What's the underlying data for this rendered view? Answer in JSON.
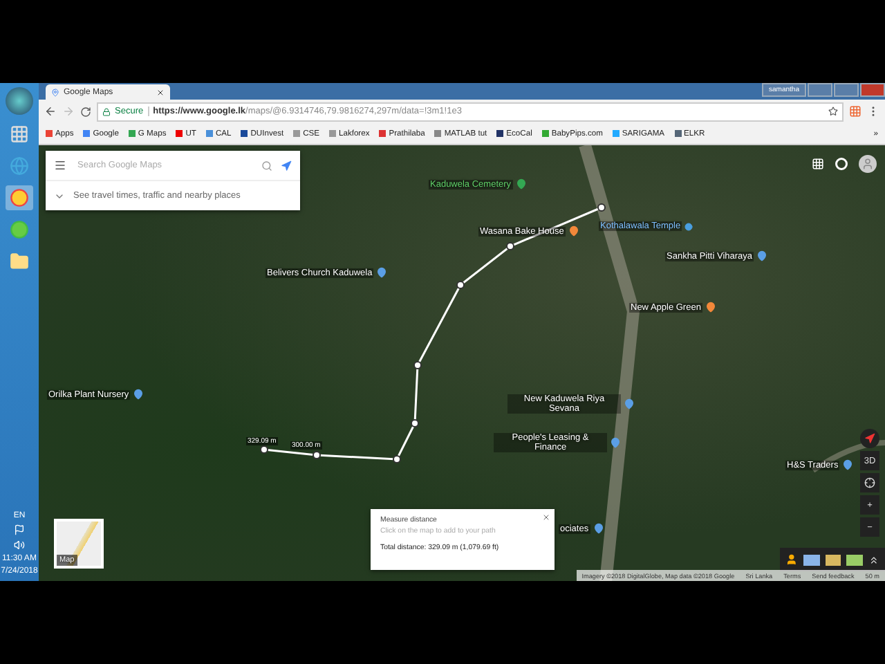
{
  "taskbar": {
    "language": "EN",
    "time": "11:30 AM",
    "date": "7/24/2018"
  },
  "window": {
    "user": "samantha",
    "tab_title": "Google Maps"
  },
  "address_bar": {
    "secure_label": "Secure",
    "url_host": "https://www.google.lk",
    "url_path": "/maps/@6.9314746,79.9816274,297m/data=!3m1!1e3"
  },
  "bookmarks": [
    "Apps",
    "Google",
    "G Maps",
    "UT",
    "CAL",
    "DUInvest",
    "CSE",
    "Lakforex",
    "Prathilaba",
    "MATLAB tut",
    "EcoCal",
    "BabyPips.com",
    "SARIGAMA",
    "ELKR"
  ],
  "bookmarks_more": "»",
  "search": {
    "placeholder": "Search Google Maps",
    "hint": "See travel times, traffic and nearby places"
  },
  "places": [
    {
      "name": "Kaduwela Cemetery",
      "kind": "park",
      "color": "#34a853"
    },
    {
      "name": "Wasana Bake House",
      "kind": "food",
      "color": "#f2883a"
    },
    {
      "name": "Kothalawala Temple",
      "kind": "transit",
      "color": "#4a9fe0"
    },
    {
      "name": "Sankha Pitti Viharaya",
      "kind": "place",
      "color": "#5b9fe6"
    },
    {
      "name": "New Apple Green",
      "kind": "food",
      "color": "#f2883a"
    },
    {
      "name": "Belivers Church Kaduwela",
      "kind": "place",
      "color": "#5b9fe6"
    },
    {
      "name": "Orilka Plant Nursery",
      "kind": "place",
      "color": "#5b9fe6"
    },
    {
      "name": "New Kaduwela Riya Sevana",
      "kind": "place",
      "color": "#5b9fe6"
    },
    {
      "name": "People's Leasing & Finance",
      "kind": "place",
      "color": "#5b9fe6"
    },
    {
      "name": "H&S Traders",
      "kind": "place",
      "color": "#5b9fe6"
    },
    {
      "name": "ociates",
      "kind": "place",
      "color": "#5b9fe6"
    }
  ],
  "route_labels": [
    "329.09 m",
    "300.00 m"
  ],
  "measure": {
    "title": "Measure distance",
    "hint": "Click on the map to add to your path",
    "total": "Total distance: 329.09 m (1,079.69 ft)"
  },
  "map_controls": {
    "tilt": "3D",
    "zoom_in": "+",
    "zoom_out": "−"
  },
  "layer_thumb": "Map",
  "footer": [
    "Imagery ©2018 DigitalGlobe, Map data ©2018 Google",
    "Sri Lanka",
    "Terms",
    "Send feedback",
    "50 m"
  ]
}
